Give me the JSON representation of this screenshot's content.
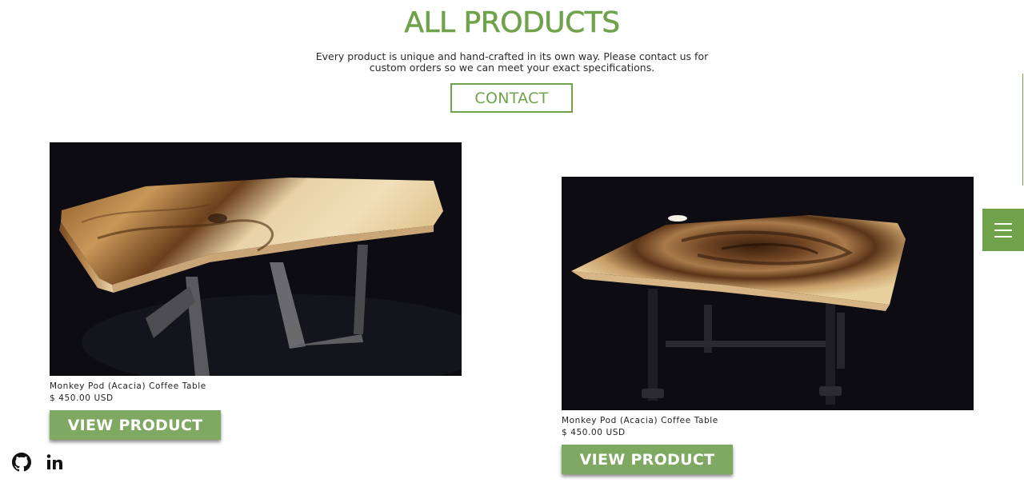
{
  "header": {
    "title": "ALL PRODUCTS",
    "intro": "Every product is unique and hand-crafted in its own way. Please contact us for custom orders so we can meet your exact specifications.",
    "contact_label": "CONTACT"
  },
  "products": [
    {
      "name": "Monkey Pod (Acacia) Coffee Table",
      "price": "$ 450.00 USD",
      "button_label": "VIEW PRODUCT"
    },
    {
      "name": "Monkey Pod (Acacia) Coffee Table",
      "price": "$ 450.00 USD",
      "button_label": "VIEW PRODUCT"
    }
  ],
  "icons": {
    "menu": "hamburger-icon",
    "social": [
      "github-icon",
      "linkedin-icon"
    ]
  },
  "colors": {
    "accent": "#6fa24a",
    "button": "#7fa862",
    "photo_background": "#0c0c12"
  }
}
